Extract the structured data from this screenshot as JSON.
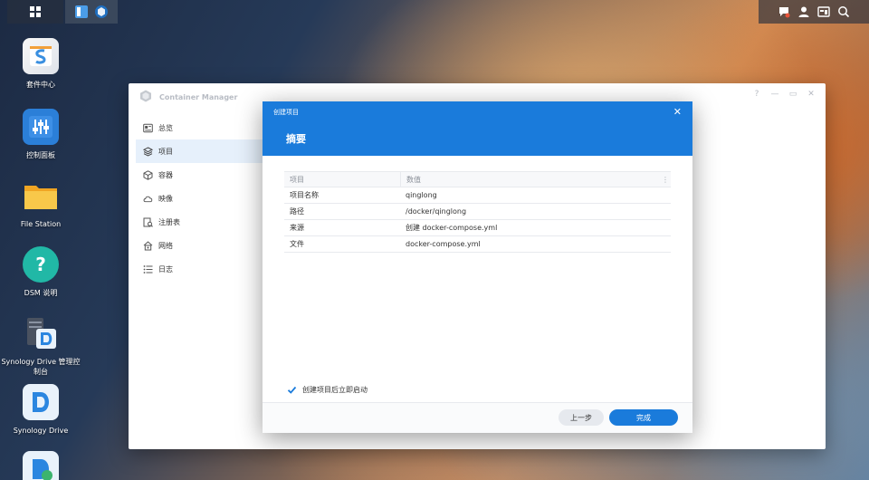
{
  "desktop": {
    "icons": [
      {
        "label": "套件中心",
        "icon": "package-center-icon"
      },
      {
        "label": "控制面板",
        "icon": "control-panel-icon"
      },
      {
        "label": "File Station",
        "icon": "folder-icon"
      },
      {
        "label": "DSM 说明",
        "icon": "help-icon"
      },
      {
        "label": "Synology Drive 管理控制台",
        "icon": "drive-admin-icon"
      },
      {
        "label": "Synology Drive",
        "icon": "drive-icon"
      }
    ]
  },
  "window": {
    "title": "Container Manager",
    "controls": [
      "?",
      "—",
      "▭",
      "✕"
    ],
    "sidebar": [
      {
        "label": "总览",
        "icon": "overview-icon",
        "active": false
      },
      {
        "label": "项目",
        "icon": "project-icon",
        "active": true
      },
      {
        "label": "容器",
        "icon": "container-icon",
        "active": false
      },
      {
        "label": "映像",
        "icon": "image-cloud-icon",
        "active": false
      },
      {
        "label": "注册表",
        "icon": "registry-icon",
        "active": false
      },
      {
        "label": "网络",
        "icon": "network-icon",
        "active": false
      },
      {
        "label": "日志",
        "icon": "log-icon",
        "active": false
      }
    ]
  },
  "dialog": {
    "small_title": "创建项目",
    "title": "摘要",
    "close": "✕",
    "table": {
      "headers": [
        "项目",
        "数值"
      ],
      "more": "⋮",
      "rows": [
        [
          "项目名称",
          "qinglong"
        ],
        [
          "路径",
          "/docker/qinglong"
        ],
        [
          "来源",
          "创建 docker-compose.yml"
        ],
        [
          "文件",
          "docker-compose.yml"
        ]
      ]
    },
    "checkbox_label": "创建项目后立即启动",
    "checkbox_checked": true,
    "btn_prev": "上一步",
    "btn_done": "完成"
  },
  "colors": {
    "accent": "#1a7bdb",
    "sidebar_active": "#e6f0fb"
  }
}
